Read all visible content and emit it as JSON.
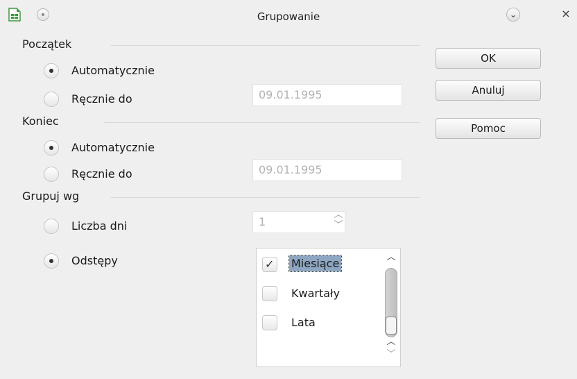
{
  "window": {
    "title": "Grupowanie",
    "icons": [
      "spreadsheet-app-icon",
      "window-menu-icon",
      "minimize-icon",
      "close-icon"
    ],
    "close_symbol": "×",
    "minimize_symbol": "⌄"
  },
  "start": {
    "label": "Początek",
    "auto_label": "Automatycznie",
    "manual_label": "Ręcznie do",
    "selected": "auto",
    "date_value": "09.01.1995"
  },
  "end": {
    "label": "Koniec",
    "auto_label": "Automatycznie",
    "manual_label": "Ręcznie do",
    "selected": "auto",
    "date_value": "09.01.1995"
  },
  "group_by": {
    "label": "Grupuj wg",
    "days_label": "Liczba dni",
    "days_value": "1",
    "intervals_label": "Odstępy",
    "selected": "intervals",
    "intervals": [
      {
        "label": "Miesiące",
        "checked": true,
        "selected": true
      },
      {
        "label": "Kwartały",
        "checked": false,
        "selected": false
      },
      {
        "label": "Lata",
        "checked": false,
        "selected": false
      }
    ]
  },
  "buttons": {
    "ok": "OK",
    "cancel": "Anuluj",
    "help": "Pomoc"
  },
  "colors": {
    "background": "#efefef",
    "selection": "#8ea6c1",
    "app_icon_green": "#3a9a3a"
  }
}
